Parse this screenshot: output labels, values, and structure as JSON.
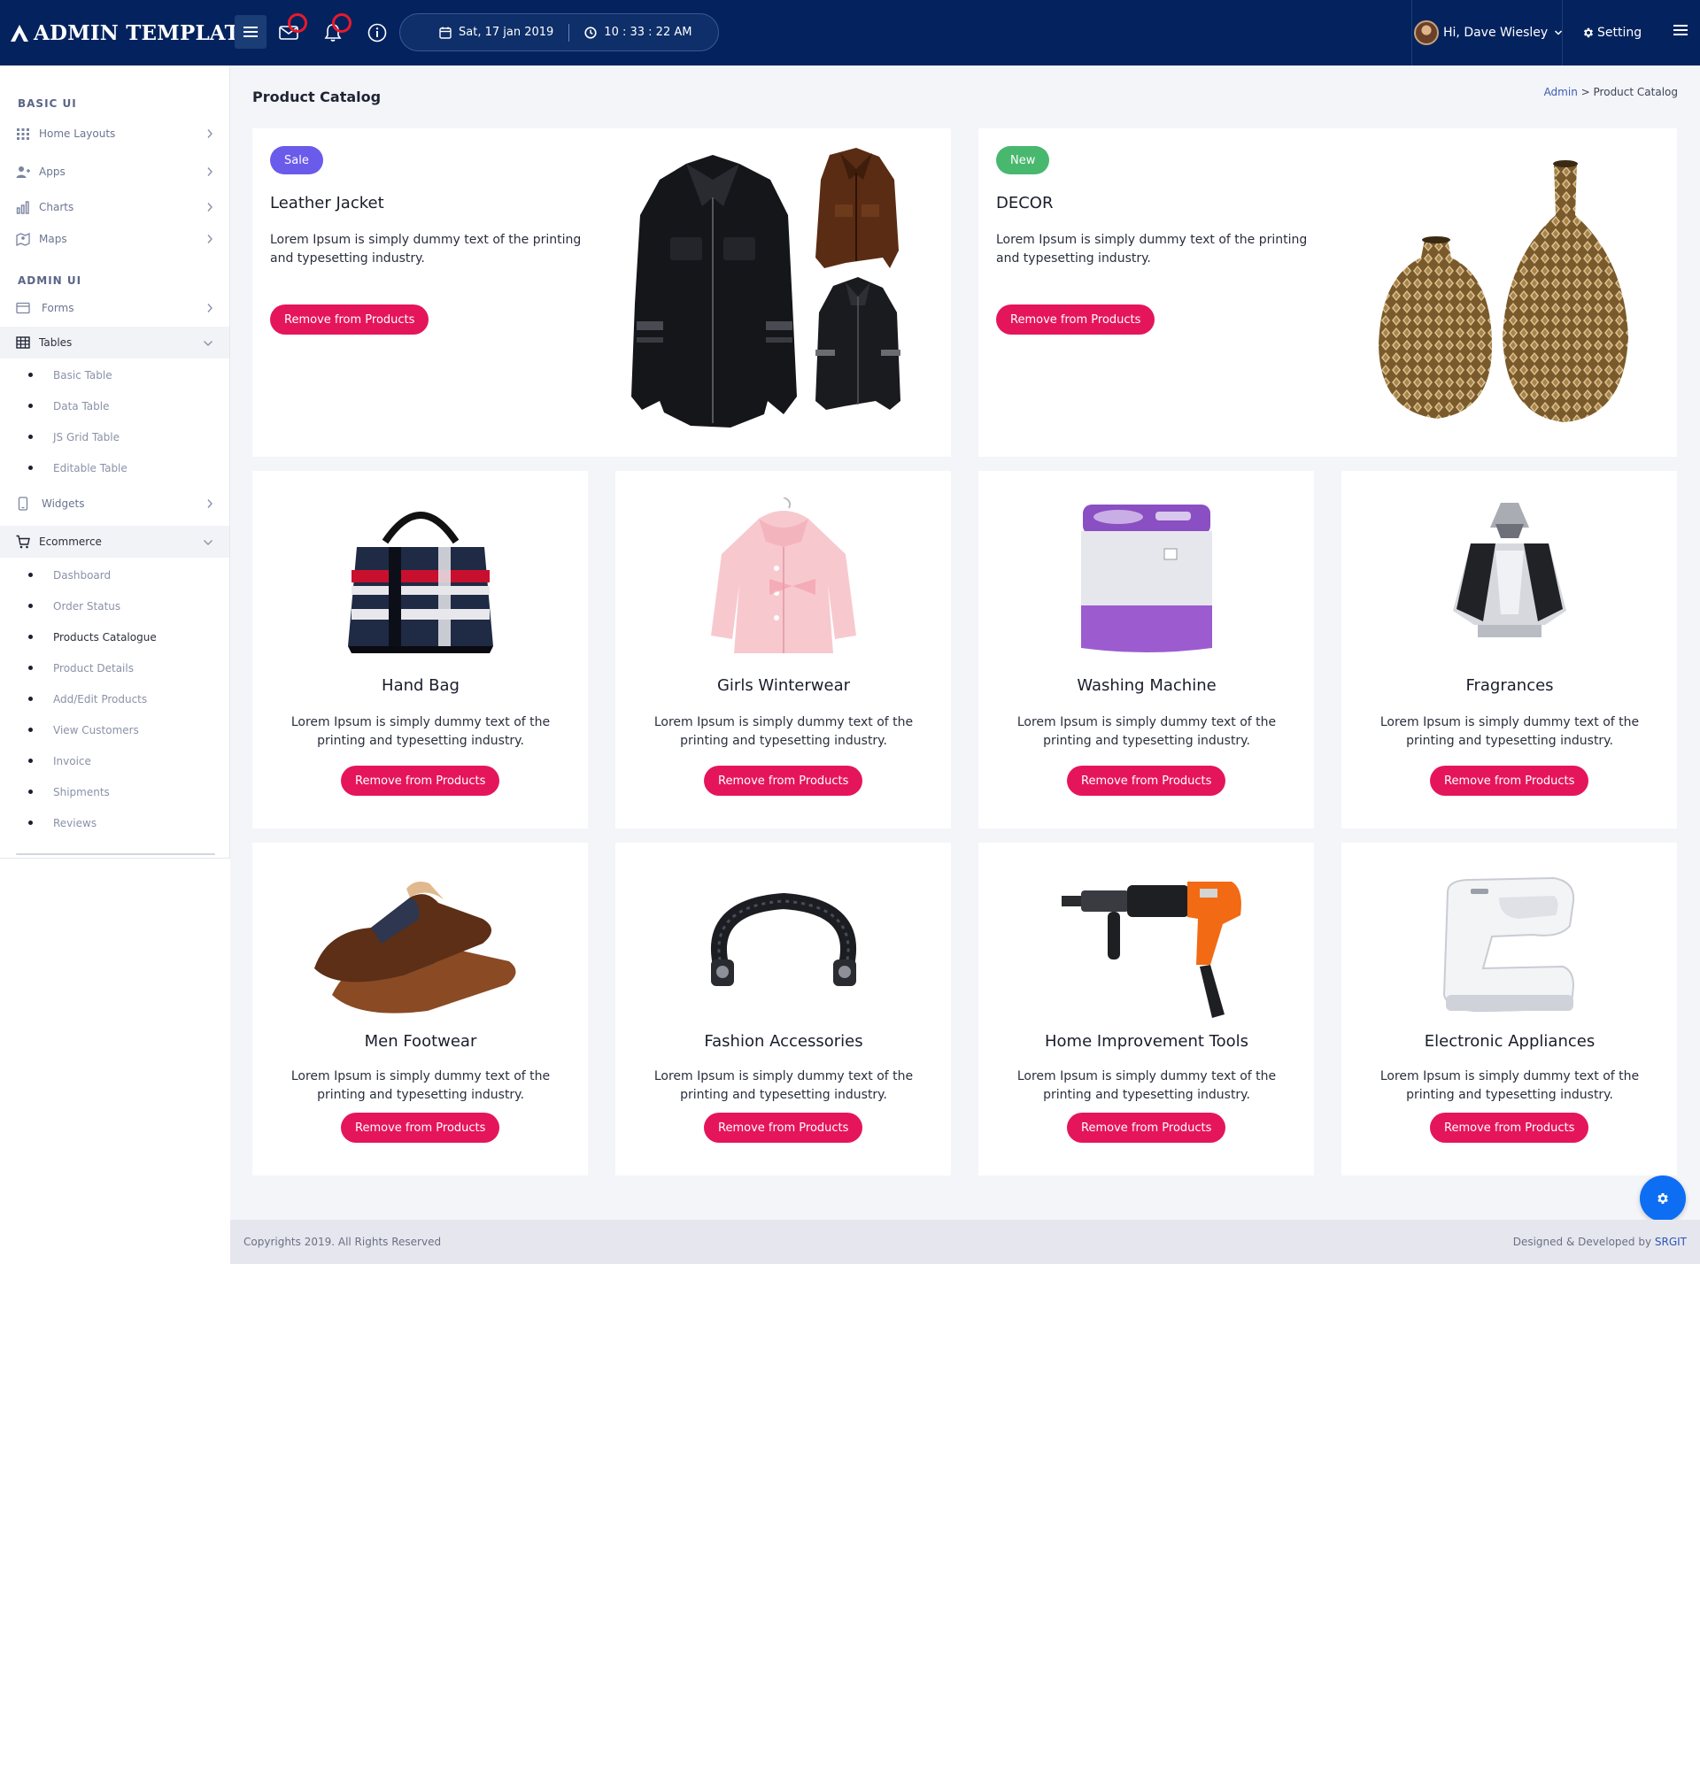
{
  "app": {
    "logo_text": "ADMIN TEMPLATE",
    "date": "Sat, 17 jan 2019",
    "time": "10 : 33 : 22 AM",
    "user_greeting": "Hi, Dave Wiesley",
    "setting_label": "Setting"
  },
  "icons": {
    "menu": "hamburger-icon",
    "mail": "mail-icon",
    "notifications": "bell-icon",
    "info": "info-icon",
    "calendar": "calendar-icon",
    "clock": "clock-icon",
    "settings": "gear-icon"
  },
  "sidebar": {
    "basic_heading": "BASIC UI",
    "admin_heading": "ADMIN UI",
    "home_layouts": "Home Layouts",
    "apps": "Apps",
    "charts": "Charts",
    "maps": "Maps",
    "forms": "Forms",
    "tables": "Tables",
    "tables_sub": [
      "Basic Table",
      "Data Table",
      "JS Grid Table",
      "Editable Table"
    ],
    "widgets": "Widgets",
    "ecommerce": "Ecommerce",
    "ecommerce_sub": [
      "Dashboard",
      "Order Status",
      "Products Catalogue",
      "Product Details",
      "Add/Edit Products",
      "View Customers",
      "Invoice",
      "Shipments",
      "Reviews"
    ]
  },
  "page": {
    "title": "Product Catalog",
    "breadcrumb_root": "Admin",
    "breadcrumb_sep": ">",
    "breadcrumb_current": "Product Catalog"
  },
  "featured": [
    {
      "badge": "Sale",
      "title": "Leather Jacket",
      "desc": "Lorem Ipsum is simply dummy text of the printing and typesetting industry.",
      "button": "Remove from Products"
    },
    {
      "badge": "New",
      "title": "DECOR",
      "desc": "Lorem Ipsum is simply dummy text of the printing and typesetting industry.",
      "button": "Remove from Products"
    }
  ],
  "products": [
    {
      "name": "Hand Bag",
      "desc": "Lorem Ipsum is simply dummy text of the printing and typesetting industry.",
      "button": "Remove from Products"
    },
    {
      "name": "Girls Winterwear",
      "desc": "Lorem Ipsum is simply dummy text of the printing and typesetting industry.",
      "button": "Remove from Products"
    },
    {
      "name": "Washing Machine",
      "desc": "Lorem Ipsum is simply dummy text of the printing and typesetting industry.",
      "button": "Remove from Products"
    },
    {
      "name": "Fragrances",
      "desc": "Lorem Ipsum is simply dummy text of the printing and typesetting industry.",
      "button": "Remove from Products"
    },
    {
      "name": "Men Footwear",
      "desc": "Lorem Ipsum is simply dummy text of the printing and typesetting industry.",
      "button": "Remove from Products"
    },
    {
      "name": "Fashion Accessories",
      "desc": "Lorem Ipsum is simply dummy text of the printing and typesetting industry.",
      "button": "Remove from Products"
    },
    {
      "name": "Home Improvement Tools",
      "desc": "Lorem Ipsum is simply dummy text of the printing and typesetting industry.",
      "button": "Remove from Products"
    },
    {
      "name": "Electronic Appliances",
      "desc": "Lorem Ipsum is simply dummy text of the printing and typesetting industry.",
      "button": "Remove from Products"
    }
  ],
  "footer": {
    "copyright": "Copyrights 2019. All Rights Reserved",
    "credit_prefix": "Designed & Developed by ",
    "credit_brand": "SRGIT"
  },
  "colors": {
    "topbar": "#04235e",
    "accent_pink": "#e5155c",
    "sale_badge": "#6a5bea",
    "new_badge": "#49b86f",
    "fab": "#0d6ef3"
  }
}
